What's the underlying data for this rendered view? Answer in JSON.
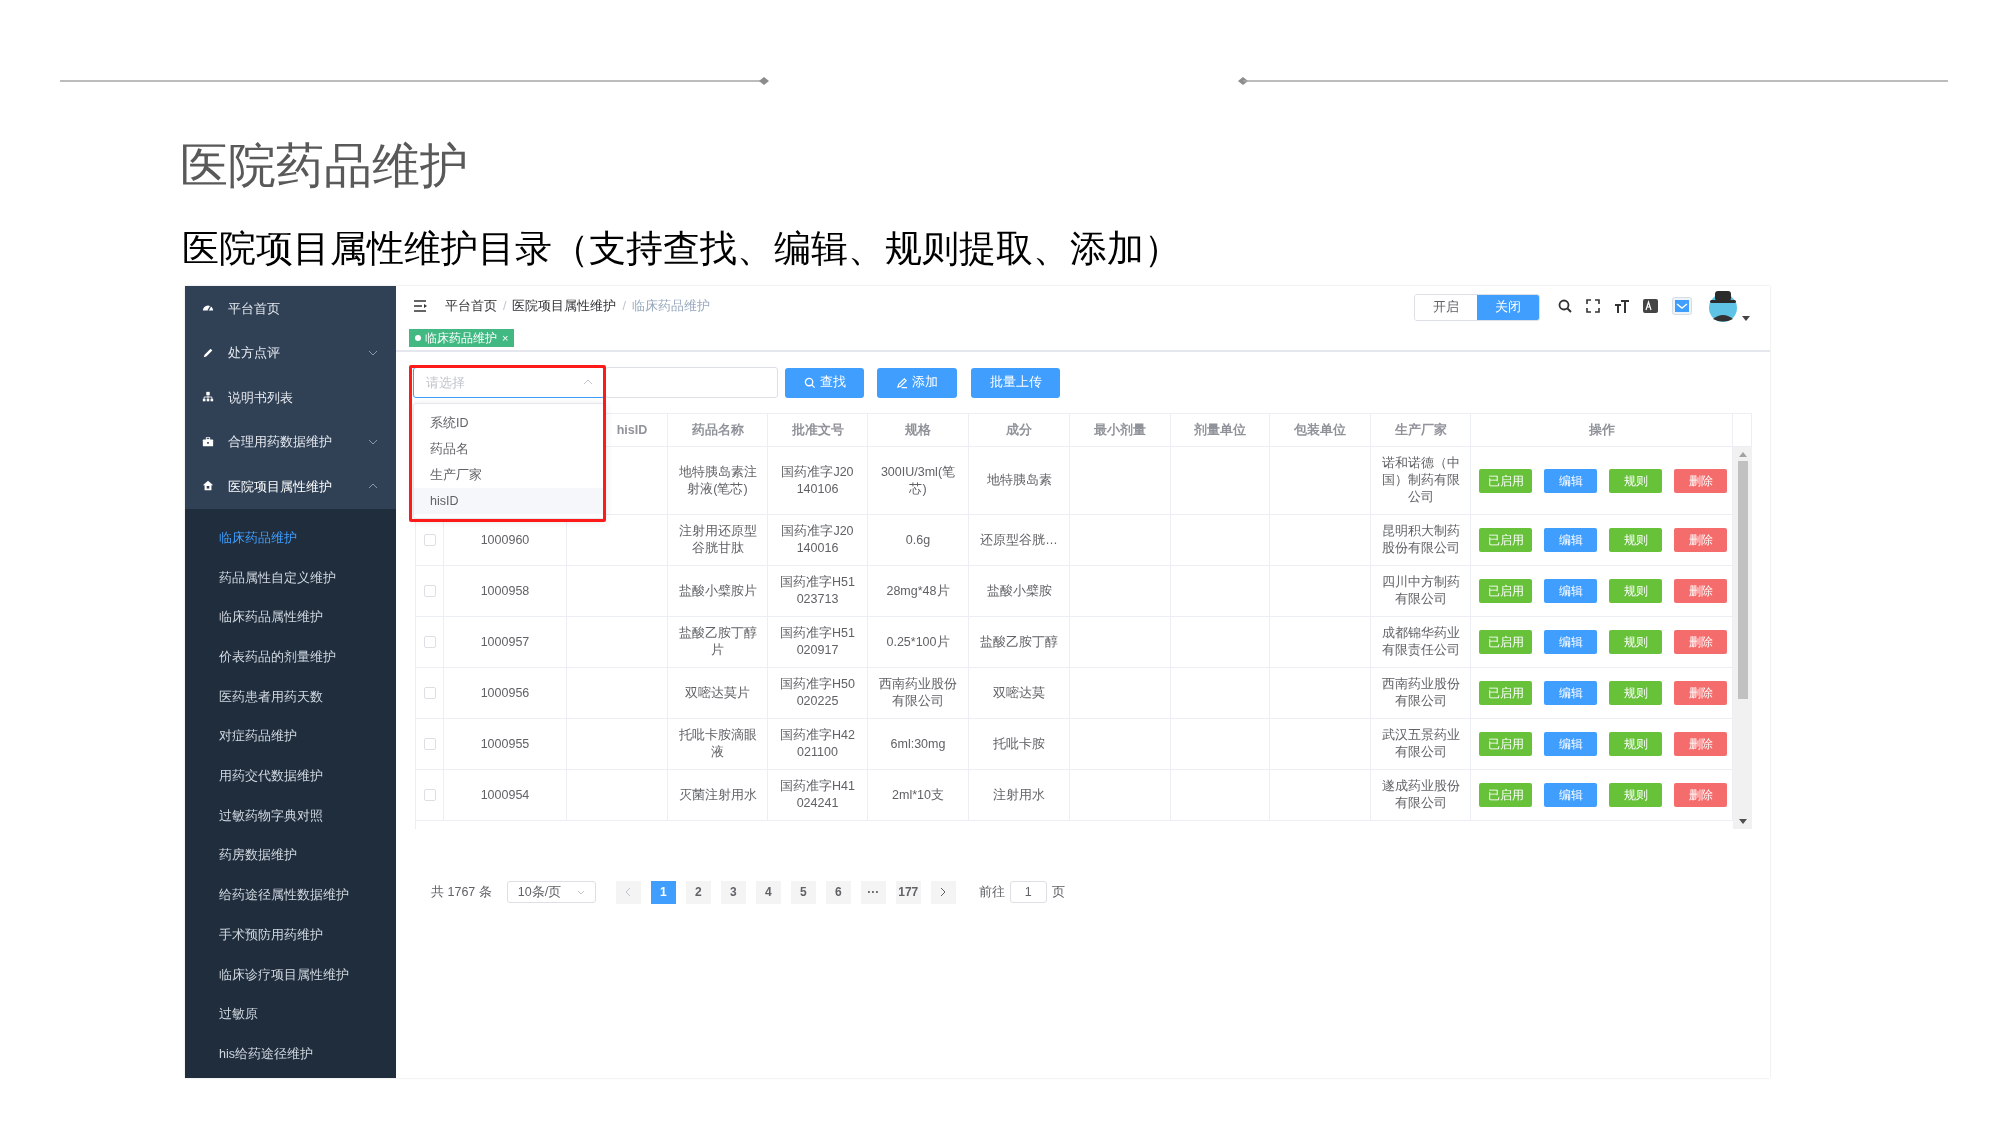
{
  "slide": {
    "title": "医院药品维护",
    "subtitle": "医院项目属性维护目录（支持查找、编辑、规则提取、添加）"
  },
  "sidebar": {
    "items": [
      {
        "label": "平台首页"
      },
      {
        "label": "处方点评",
        "expanded": false
      },
      {
        "label": "说明书列表"
      },
      {
        "label": "合理用药数据维护",
        "expanded": false
      },
      {
        "label": "医院项目属性维护",
        "expanded": true,
        "children": [
          {
            "label": "临床药品维护",
            "selected": true
          },
          {
            "label": "药品属性自定义维护",
            "selected": false
          },
          {
            "label": "临床药品属性维护",
            "selected": false
          },
          {
            "label": "价表药品的剂量维护",
            "selected": false
          },
          {
            "label": "医药患者用药天数",
            "selected": false
          },
          {
            "label": "对症药品维护",
            "selected": false
          },
          {
            "label": "用药交代数据维护",
            "selected": false
          },
          {
            "label": "过敏药物字典对照",
            "selected": false
          },
          {
            "label": "药房数据维护",
            "selected": false
          },
          {
            "label": "给药途径属性数据维护",
            "selected": false
          },
          {
            "label": "手术预防用药维护",
            "selected": false
          },
          {
            "label": "临床诊疗项目属性维护",
            "selected": false
          },
          {
            "label": "过敏原",
            "selected": false
          },
          {
            "label": "his给药途径维护",
            "selected": false
          }
        ]
      }
    ]
  },
  "header": {
    "breadcrumb": [
      {
        "label": "平台首页",
        "current": false
      },
      {
        "label": "医院项目属性维护",
        "current": false
      },
      {
        "label": "临床药品维护",
        "current": true
      }
    ],
    "separator": "/",
    "toggle": [
      {
        "label": "开启",
        "selected": false
      },
      {
        "label": "关闭",
        "selected": true
      }
    ]
  },
  "tags": [
    {
      "label": "临床药品维护",
      "close": "×",
      "selected": true
    }
  ],
  "toolbar": {
    "select": {
      "placeholder": "请选择",
      "open": true,
      "options": [
        {
          "label": "系统ID",
          "highlighted": false
        },
        {
          "label": "药品名",
          "highlighted": false
        },
        {
          "label": "生产厂家",
          "highlighted": false
        },
        {
          "label": "hisID",
          "highlighted": true
        }
      ]
    },
    "buttons": [
      {
        "label": "查找",
        "kind": "search"
      },
      {
        "label": "添加",
        "kind": "add"
      },
      {
        "label": "批量上传",
        "kind": "upload"
      }
    ]
  },
  "table": {
    "columns": [
      "hisID",
      "药品名称",
      "批准文号",
      "规格",
      "成分",
      "最小剂量",
      "剂量单位",
      "包装单位",
      "生产厂家",
      "操作"
    ],
    "rows": [
      {
        "drug_name": "地特胰岛素注射液(笔芯)",
        "approval_no": "国药准字J20140106",
        "spec": "300IU/3ml(笔芯)",
        "ingredient": "地特胰岛素",
        "manufacturer": "诺和诺德（中国）制药有限公司",
        "actions": [
          {
            "label": "已启用",
            "kind": "status"
          },
          {
            "label": "编辑",
            "kind": "edit"
          },
          {
            "label": "规则",
            "kind": "rule"
          },
          {
            "label": "删除",
            "kind": "delete"
          }
        ]
      },
      {
        "checked": false,
        "system_id": "1000960",
        "drug_name": "注射用还原型谷胱甘肽",
        "approval_no": "国药准字J20140016",
        "spec": "0.6g",
        "ingredient": "还原型谷胱…",
        "manufacturer": "昆明积大制药股份有限公司",
        "actions": [
          {
            "label": "已启用",
            "kind": "status"
          },
          {
            "label": "编辑",
            "kind": "edit"
          },
          {
            "label": "规则",
            "kind": "rule"
          },
          {
            "label": "删除",
            "kind": "delete"
          }
        ]
      },
      {
        "checked": false,
        "system_id": "1000958",
        "drug_name": "盐酸小檗胺片",
        "approval_no": "国药准字H51023713",
        "spec": "28mg*48片",
        "ingredient": "盐酸小檗胺",
        "manufacturer": "四川中方制药有限公司",
        "actions": [
          {
            "label": "已启用",
            "kind": "status"
          },
          {
            "label": "编辑",
            "kind": "edit"
          },
          {
            "label": "规则",
            "kind": "rule"
          },
          {
            "label": "删除",
            "kind": "delete"
          }
        ]
      },
      {
        "checked": false,
        "system_id": "1000957",
        "drug_name": "盐酸乙胺丁醇片",
        "approval_no": "国药准字H51020917",
        "spec": "0.25*100片",
        "ingredient": "盐酸乙胺丁醇",
        "manufacturer": "成都锦华药业有限责任公司",
        "actions": [
          {
            "label": "已启用",
            "kind": "status"
          },
          {
            "label": "编辑",
            "kind": "edit"
          },
          {
            "label": "规则",
            "kind": "rule"
          },
          {
            "label": "删除",
            "kind": "delete"
          }
        ]
      },
      {
        "checked": false,
        "system_id": "1000956",
        "drug_name": "双嘧达莫片",
        "approval_no": "国药准字H50020225",
        "spec": "西南药业股份有限公司",
        "ingredient": "双嘧达莫",
        "manufacturer": "西南药业股份有限公司",
        "actions": [
          {
            "label": "已启用",
            "kind": "status"
          },
          {
            "label": "编辑",
            "kind": "edit"
          },
          {
            "label": "规则",
            "kind": "rule"
          },
          {
            "label": "删除",
            "kind": "delete"
          }
        ]
      },
      {
        "checked": false,
        "system_id": "1000955",
        "drug_name": "托吡卡胺滴眼液",
        "approval_no": "国药准字H42021100",
        "spec": "6ml:30mg",
        "ingredient": "托吡卡胺",
        "manufacturer": "武汉五景药业有限公司",
        "actions": [
          {
            "label": "已启用",
            "kind": "status"
          },
          {
            "label": "编辑",
            "kind": "edit"
          },
          {
            "label": "规则",
            "kind": "rule"
          },
          {
            "label": "删除",
            "kind": "delete"
          }
        ]
      },
      {
        "checked": false,
        "system_id": "1000954",
        "drug_name": "灭菌注射用水",
        "approval_no": "国药准字H41024241",
        "spec": "2ml*10支",
        "ingredient": "注射用水",
        "manufacturer": "遂成药业股份有限公司",
        "actions": [
          {
            "label": "已启用",
            "kind": "status"
          },
          {
            "label": "编辑",
            "kind": "edit"
          },
          {
            "label": "规则",
            "kind": "rule"
          },
          {
            "label": "删除",
            "kind": "delete"
          }
        ]
      }
    ]
  },
  "pagination": {
    "total": "共 1767 条",
    "page_size": "10条/页",
    "pages": [
      {
        "label": "1",
        "selected": true
      },
      {
        "label": "2",
        "selected": false
      },
      {
        "label": "3",
        "selected": false
      },
      {
        "label": "4",
        "selected": false
      },
      {
        "label": "5",
        "selected": false
      },
      {
        "label": "6",
        "selected": false
      },
      {
        "label": "···",
        "selected": false
      },
      {
        "label": "177",
        "selected": false
      }
    ],
    "goto_label": "前往",
    "goto_value": "1",
    "goto_unit": "页"
  }
}
